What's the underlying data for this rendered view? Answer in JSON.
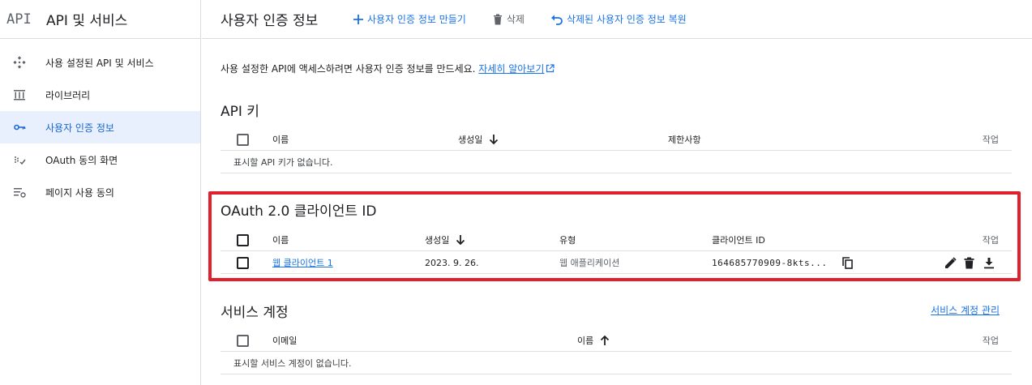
{
  "sidebar": {
    "logo": "API",
    "title": "API 및 서비스",
    "items": [
      {
        "label": "사용 설정된 API 및 서비스",
        "icon": "enabled-apis-icon",
        "active": false
      },
      {
        "label": "라이브러리",
        "icon": "library-icon",
        "active": false
      },
      {
        "label": "사용자 인증 정보",
        "icon": "key-icon",
        "active": true
      },
      {
        "label": "OAuth 동의 화면",
        "icon": "oauth-consent-icon",
        "active": false
      },
      {
        "label": "페이지 사용 동의",
        "icon": "page-usage-icon",
        "active": false
      }
    ]
  },
  "topbar": {
    "title": "사용자 인증 정보",
    "create_label": "사용자 인증 정보 만들기",
    "delete_label": "삭제",
    "restore_label": "삭제된 사용자 인증 정보 복원"
  },
  "intro": {
    "text": "사용 설정한 API에 액세스하려면 사용자 인증 정보를 만드세요. ",
    "link": "자세히 알아보기"
  },
  "api_keys": {
    "title": "API 키",
    "columns": {
      "name": "이름",
      "created": "생성일",
      "restrictions": "제한사항",
      "actions": "작업"
    },
    "empty": "표시할 API 키가 없습니다."
  },
  "oauth": {
    "title": "OAuth 2.0 클라이언트 ID",
    "columns": {
      "name": "이름",
      "created": "생성일",
      "type": "유형",
      "client_id": "클라이언트 ID",
      "actions": "작업"
    },
    "rows": [
      {
        "name": "웹 클라이언트 1",
        "created": "2023. 9. 26.",
        "type": "웹 애플리케이션",
        "client_id": "164685770909-8kts..."
      }
    ]
  },
  "service_accounts": {
    "title": "서비스 계정",
    "manage_link": "서비스 계정 관리",
    "columns": {
      "email": "이메일",
      "name": "이름",
      "actions": "작업"
    },
    "empty": "표시할 서비스 계정이 없습니다."
  },
  "colors": {
    "accent": "#1a73e8",
    "highlight": "#e0202c",
    "active_bg": "#e8f0fe"
  }
}
